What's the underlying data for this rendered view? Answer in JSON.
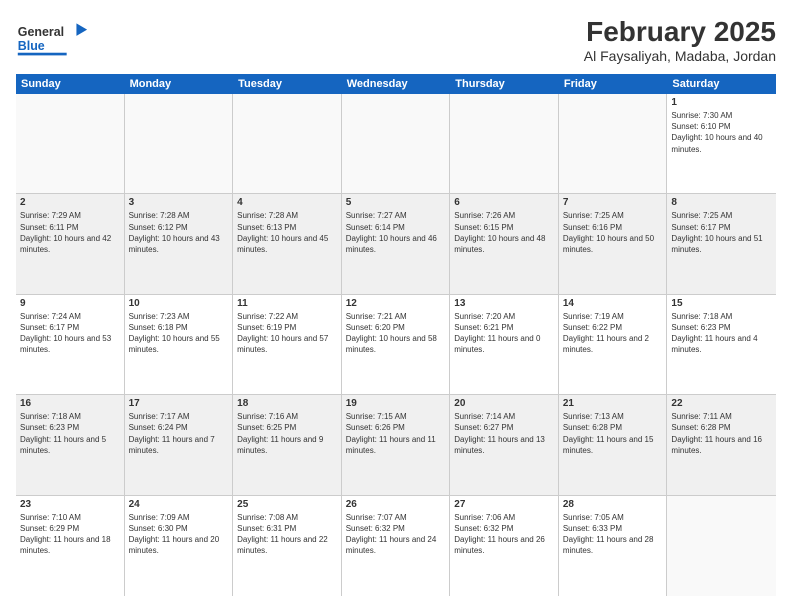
{
  "header": {
    "logo_general": "General",
    "logo_blue": "Blue",
    "main_title": "February 2025",
    "subtitle": "Al Faysaliyah, Madaba, Jordan"
  },
  "days_of_week": [
    "Sunday",
    "Monday",
    "Tuesday",
    "Wednesday",
    "Thursday",
    "Friday",
    "Saturday"
  ],
  "weeks": [
    [
      {
        "day": "",
        "empty": true
      },
      {
        "day": "",
        "empty": true
      },
      {
        "day": "",
        "empty": true
      },
      {
        "day": "",
        "empty": true
      },
      {
        "day": "",
        "empty": true
      },
      {
        "day": "",
        "empty": true
      },
      {
        "day": "1",
        "sunrise": "7:30 AM",
        "sunset": "6:10 PM",
        "daylight": "10 hours and 40 minutes."
      }
    ],
    [
      {
        "day": "2",
        "sunrise": "7:29 AM",
        "sunset": "6:11 PM",
        "daylight": "10 hours and 42 minutes."
      },
      {
        "day": "3",
        "sunrise": "7:28 AM",
        "sunset": "6:12 PM",
        "daylight": "10 hours and 43 minutes."
      },
      {
        "day": "4",
        "sunrise": "7:28 AM",
        "sunset": "6:13 PM",
        "daylight": "10 hours and 45 minutes."
      },
      {
        "day": "5",
        "sunrise": "7:27 AM",
        "sunset": "6:14 PM",
        "daylight": "10 hours and 46 minutes."
      },
      {
        "day": "6",
        "sunrise": "7:26 AM",
        "sunset": "6:15 PM",
        "daylight": "10 hours and 48 minutes."
      },
      {
        "day": "7",
        "sunrise": "7:25 AM",
        "sunset": "6:16 PM",
        "daylight": "10 hours and 50 minutes."
      },
      {
        "day": "8",
        "sunrise": "7:25 AM",
        "sunset": "6:17 PM",
        "daylight": "10 hours and 51 minutes."
      }
    ],
    [
      {
        "day": "9",
        "sunrise": "7:24 AM",
        "sunset": "6:17 PM",
        "daylight": "10 hours and 53 minutes."
      },
      {
        "day": "10",
        "sunrise": "7:23 AM",
        "sunset": "6:18 PM",
        "daylight": "10 hours and 55 minutes."
      },
      {
        "day": "11",
        "sunrise": "7:22 AM",
        "sunset": "6:19 PM",
        "daylight": "10 hours and 57 minutes."
      },
      {
        "day": "12",
        "sunrise": "7:21 AM",
        "sunset": "6:20 PM",
        "daylight": "10 hours and 58 minutes."
      },
      {
        "day": "13",
        "sunrise": "7:20 AM",
        "sunset": "6:21 PM",
        "daylight": "11 hours and 0 minutes."
      },
      {
        "day": "14",
        "sunrise": "7:19 AM",
        "sunset": "6:22 PM",
        "daylight": "11 hours and 2 minutes."
      },
      {
        "day": "15",
        "sunrise": "7:18 AM",
        "sunset": "6:23 PM",
        "daylight": "11 hours and 4 minutes."
      }
    ],
    [
      {
        "day": "16",
        "sunrise": "7:18 AM",
        "sunset": "6:23 PM",
        "daylight": "11 hours and 5 minutes."
      },
      {
        "day": "17",
        "sunrise": "7:17 AM",
        "sunset": "6:24 PM",
        "daylight": "11 hours and 7 minutes."
      },
      {
        "day": "18",
        "sunrise": "7:16 AM",
        "sunset": "6:25 PM",
        "daylight": "11 hours and 9 minutes."
      },
      {
        "day": "19",
        "sunrise": "7:15 AM",
        "sunset": "6:26 PM",
        "daylight": "11 hours and 11 minutes."
      },
      {
        "day": "20",
        "sunrise": "7:14 AM",
        "sunset": "6:27 PM",
        "daylight": "11 hours and 13 minutes."
      },
      {
        "day": "21",
        "sunrise": "7:13 AM",
        "sunset": "6:28 PM",
        "daylight": "11 hours and 15 minutes."
      },
      {
        "day": "22",
        "sunrise": "7:11 AM",
        "sunset": "6:28 PM",
        "daylight": "11 hours and 16 minutes."
      }
    ],
    [
      {
        "day": "23",
        "sunrise": "7:10 AM",
        "sunset": "6:29 PM",
        "daylight": "11 hours and 18 minutes."
      },
      {
        "day": "24",
        "sunrise": "7:09 AM",
        "sunset": "6:30 PM",
        "daylight": "11 hours and 20 minutes."
      },
      {
        "day": "25",
        "sunrise": "7:08 AM",
        "sunset": "6:31 PM",
        "daylight": "11 hours and 22 minutes."
      },
      {
        "day": "26",
        "sunrise": "7:07 AM",
        "sunset": "6:32 PM",
        "daylight": "11 hours and 24 minutes."
      },
      {
        "day": "27",
        "sunrise": "7:06 AM",
        "sunset": "6:32 PM",
        "daylight": "11 hours and 26 minutes."
      },
      {
        "day": "28",
        "sunrise": "7:05 AM",
        "sunset": "6:33 PM",
        "daylight": "11 hours and 28 minutes."
      },
      {
        "day": "",
        "empty": true
      }
    ]
  ],
  "labels": {
    "sunrise": "Sunrise:",
    "sunset": "Sunset:",
    "daylight": "Daylight:"
  },
  "colors": {
    "header_bg": "#1565c0",
    "shaded_row": "#f0f0f0"
  }
}
